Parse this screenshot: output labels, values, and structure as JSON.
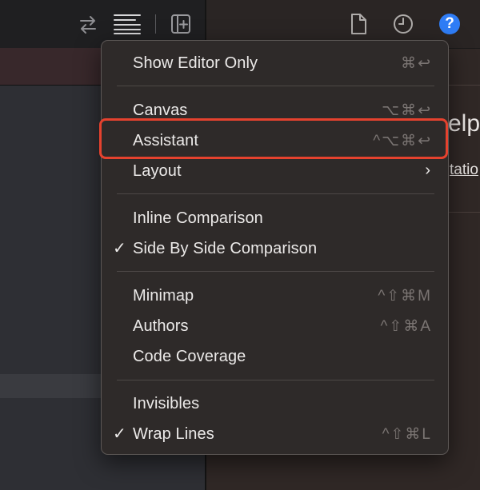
{
  "toolbar": {
    "icons": [
      "swap-arrows-icon",
      "text-lines-icon",
      "add-editor-icon",
      "document-icon",
      "history-clock-icon",
      "help-icon"
    ],
    "help_label": "?",
    "help_color": "#2f7df6"
  },
  "peek": {
    "heading_fragment": "elp",
    "link_fragment": "tatio"
  },
  "menu": {
    "items": [
      {
        "label": "Show Editor Only",
        "shortcut": "⌘↩",
        "checked": false
      },
      {
        "label": "Canvas",
        "shortcut": "⌥⌘↩",
        "checked": false
      },
      {
        "label": "Assistant",
        "shortcut": "^⌥⌘↩",
        "checked": false,
        "highlighted": true
      },
      {
        "label": "Layout",
        "submenu": "›",
        "checked": false
      },
      {
        "label": "Inline Comparison",
        "checked": false
      },
      {
        "label": "Side By Side Comparison",
        "check": "✓",
        "checked": true
      },
      {
        "label": "Minimap",
        "shortcut": "^⇧⌘M",
        "checked": false
      },
      {
        "label": "Authors",
        "shortcut": "^⇧⌘A",
        "checked": false
      },
      {
        "label": "Code Coverage",
        "checked": false
      },
      {
        "label": "Invisibles",
        "checked": false
      },
      {
        "label": "Wrap Lines",
        "check": "✓",
        "shortcut": "^⇧⌘L",
        "checked": true
      }
    ]
  },
  "highlight_color": "#e5422e"
}
